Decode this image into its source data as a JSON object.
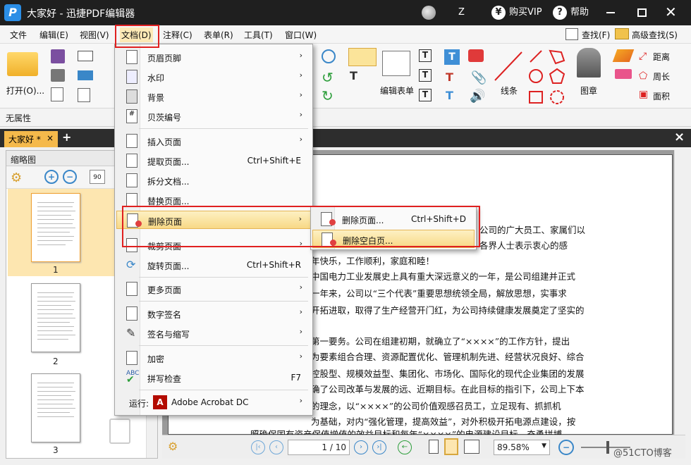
{
  "titlebar": {
    "app_logo": "P",
    "title": "大家好 - 迅捷PDF编辑器",
    "user_initial": "Z",
    "vip_label": "购买VIP",
    "help_label": "帮助"
  },
  "menubar": {
    "items": [
      "文件",
      "编辑(E)",
      "视图(V)",
      "文档(D)",
      "注释(C)",
      "表单(R)",
      "工具(T)",
      "窗口(W)"
    ],
    "find": "查找(F)",
    "advanced_find": "高级查找(S)"
  },
  "ribbon": {
    "open_label": "打开(O)...",
    "edit_form": "编辑表单",
    "line": "线条",
    "stamp": "图章",
    "distance": "距离",
    "perimeter": "周长",
    "area": "面积"
  },
  "property_bar": {
    "label": "无属性"
  },
  "tabs": {
    "doc_tab": "大家好 *",
    "add": "+",
    "close": "×"
  },
  "thumbnails": {
    "title": "缩略图",
    "pages": [
      "1",
      "2",
      "3"
    ]
  },
  "document": {
    "lines": [
      "公司的广大员工、家属们以",
      "各界人士表示衷心的感",
      "年快乐，工作顺利，家庭和睦！",
      "中国电力工业发展史上具有重大深远意义的一年，是公司组建并正式",
      "一年来，公司以“三个代表”重要思想统领全局，解放思想，实事求",
      "开拓进取，取得了生产经营开门红，为公司持续健康发展奠定了坚实的",
      "第一要务。公司在组建初期，就确立了“××××”的工作方针，提出",
      "为要素组合合理、资源配置优化、管理机制先进、经营状况良好、综合",
      "控股型、规模效益型、集团化、市场化、国际化的现代企业集团的发展",
      "确了公司改革与发展的远、近期目标。在此目标的指引下，公司上下本",
      "的理念，以“××××”的公司价值观感召员工，立足现有、抓抓机",
      "为基础，对内“强化管理，提高效益”，对外积极开拓电源点建设，按",
      "照确保国有资产保值增值的效益目标和每年“××××”的电源建设目标，奋勇拼搏，"
    ]
  },
  "status": {
    "page_display": "1 / 10",
    "zoom": "89.58%",
    "watermark": "@51CTO博客"
  },
  "doc_menu": {
    "items": [
      {
        "label": "页眉页脚",
        "shortcut": "",
        "icon": "header-footer-icon"
      },
      {
        "label": "水印",
        "shortcut": "",
        "icon": "watermark-icon"
      },
      {
        "label": "背景",
        "shortcut": "",
        "icon": "background-icon"
      },
      {
        "label": "贝茨编号",
        "shortcut": "",
        "icon": "bates-number-icon"
      },
      {
        "label": "插入页面",
        "shortcut": "",
        "icon": "insert-page-icon"
      },
      {
        "label": "提取页面...",
        "shortcut": "Ctrl+Shift+E",
        "icon": "extract-page-icon"
      },
      {
        "label": "拆分文档...",
        "shortcut": "",
        "icon": "split-document-icon"
      },
      {
        "label": "替换页面...",
        "shortcut": "",
        "icon": "replace-page-icon"
      },
      {
        "label": "删除页面",
        "shortcut": "",
        "icon": "delete-page-icon"
      },
      {
        "label": "裁剪页面",
        "shortcut": "",
        "icon": "crop-page-icon"
      },
      {
        "label": "旋转页面...",
        "shortcut": "Ctrl+Shift+R",
        "icon": "rotate-page-icon"
      },
      {
        "label": "更多页面",
        "shortcut": "",
        "icon": "more-pages-icon"
      },
      {
        "label": "数字签名",
        "shortcut": "",
        "icon": "digital-signature-icon"
      },
      {
        "label": "签名与缩写",
        "shortcut": "",
        "icon": "sign-initials-icon"
      },
      {
        "label": "加密",
        "shortcut": "",
        "icon": "encrypt-icon"
      },
      {
        "label": "拼写检查",
        "shortcut": "F7",
        "icon": "spell-check-icon"
      },
      {
        "label": "运行:",
        "shortcut": "",
        "icon": "run-icon"
      }
    ],
    "run_app": "Adobe Acrobat DC",
    "abc": "ABC"
  },
  "delete_submenu": {
    "items": [
      {
        "label": "删除页面...",
        "shortcut": "Ctrl+Shift+D"
      },
      {
        "label": "删除空白页...",
        "shortcut": ""
      }
    ]
  },
  "colors": {
    "accent": "#f5b94b",
    "highlight_red": "#e02020",
    "titlebar": "#1f1f1f"
  }
}
